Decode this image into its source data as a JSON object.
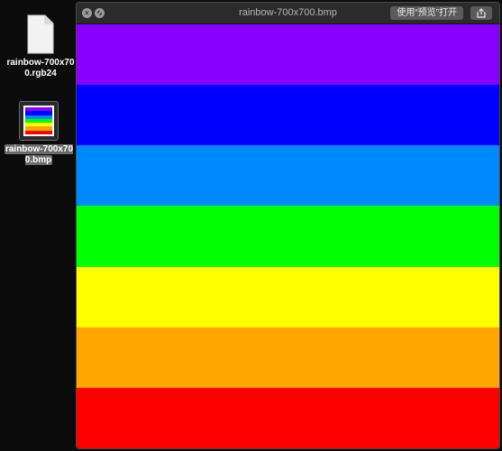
{
  "desktop": {
    "files": [
      {
        "label": "rainbow-700x700.rgb24",
        "icon": "document-icon",
        "selected": false
      },
      {
        "label": "rainbow-700x700.bmp",
        "icon": "image-thumbnail-icon",
        "selected": true
      }
    ]
  },
  "window": {
    "title": "rainbow-700x700.bmp",
    "open_button_label": "使用“预览”打开",
    "close_icon": "close-icon",
    "fullscreen_icon": "fullscreen-icon",
    "share_icon": "share-icon"
  },
  "image": {
    "stripes": [
      "#8800ff",
      "#0000ff",
      "#0088ff",
      "#00ff00",
      "#ffff00",
      "#ffa500",
      "#ff0000"
    ]
  }
}
